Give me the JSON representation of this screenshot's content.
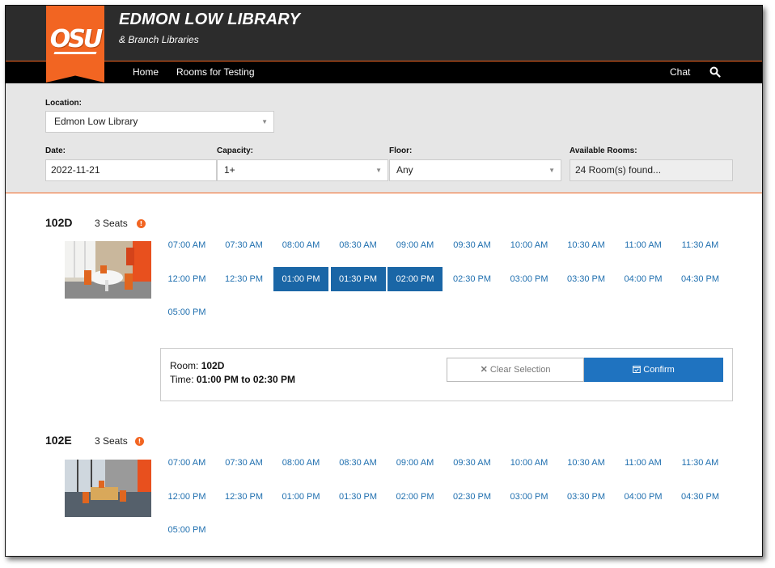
{
  "header": {
    "logo_text": "OSU",
    "title": "EDMON LOW LIBRARY",
    "subtitle": "& Branch Libraries"
  },
  "nav": {
    "home": "Home",
    "rooms_for_testing": "Rooms for Testing",
    "chat": "Chat",
    "search_icon": "search-icon"
  },
  "filters": {
    "location_label": "Location:",
    "location_value": "Edmon Low Library",
    "date_label": "Date:",
    "date_value": "2022-11-21",
    "capacity_label": "Capacity:",
    "capacity_value": "1+",
    "floor_label": "Floor:",
    "floor_value": "Any",
    "available_label": "Available Rooms:",
    "available_value": "24 Room(s) found..."
  },
  "rooms": [
    {
      "name": "102D",
      "seats": "3 Seats",
      "times": [
        "07:00 AM",
        "07:30 AM",
        "08:00 AM",
        "08:30 AM",
        "09:00 AM",
        "09:30 AM",
        "10:00 AM",
        "10:30 AM",
        "11:00 AM",
        "11:30 AM",
        "12:00 PM",
        "12:30 PM",
        "01:00 PM",
        "01:30 PM",
        "02:00 PM",
        "02:30 PM",
        "03:00 PM",
        "03:30 PM",
        "04:00 PM",
        "04:30 PM",
        "05:00 PM"
      ],
      "selected": [
        "01:00 PM",
        "01:30 PM",
        "02:00 PM"
      ]
    },
    {
      "name": "102E",
      "seats": "3 Seats",
      "times": [
        "07:00 AM",
        "07:30 AM",
        "08:00 AM",
        "08:30 AM",
        "09:00 AM",
        "09:30 AM",
        "10:00 AM",
        "10:30 AM",
        "11:00 AM",
        "11:30 AM",
        "12:00 PM",
        "12:30 PM",
        "01:00 PM",
        "01:30 PM",
        "02:00 PM",
        "02:30 PM",
        "03:00 PM",
        "03:30 PM",
        "04:00 PM",
        "04:30 PM",
        "05:00 PM"
      ],
      "selected": []
    }
  ],
  "selection": {
    "room_label": "Room:",
    "room_value": "102D",
    "time_label": "Time:",
    "time_value": "01:00 PM to 02:30 PM",
    "clear_label": "Clear Selection",
    "confirm_label": "Confirm"
  },
  "colors": {
    "brand_orange": "#f26522",
    "header_dark": "#2c2c2c",
    "link_blue": "#1f6faf",
    "selected_blue": "#1a66a6",
    "confirm_blue": "#1f73c0"
  }
}
